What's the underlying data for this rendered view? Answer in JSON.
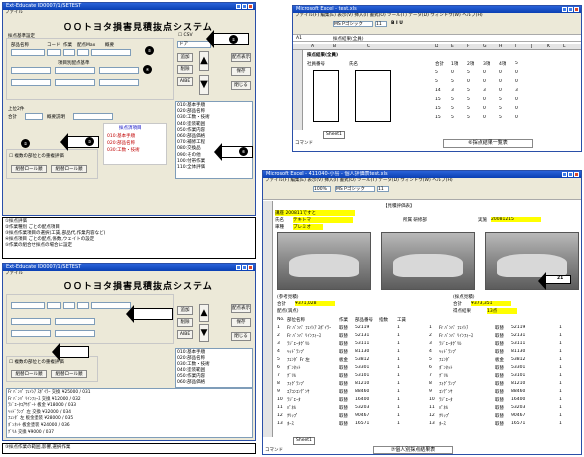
{
  "win1": {
    "title": "Ext-Educate ID0007/1/SETEST",
    "app_title": "ＯＯトヨタ損害見積抜点システム",
    "menu": "ファイル",
    "labels": [
      "採点基準設定",
      "部品名称",
      "コード",
      "作業",
      "配点Max",
      "概要",
      "配点合計",
      "項目別配点基準",
      "上位2件",
      "合計",
      "概要説明",
      "部分点(%)"
    ],
    "checkboxes": [
      "CSV",
      "複数の部位との重複評価",
      "削除ガイド",
      "設定評価"
    ],
    "buttons": [
      "追加",
      "削除",
      "保存",
      "閉じる",
      "配点表示",
      "AIBE",
      "組替ロール順",
      "組替ロール順"
    ],
    "combo": "ドア",
    "panel_title": "採点済項目",
    "list_items": [
      "010:基本手順",
      "020:部品名称",
      "030:工数・技術",
      "040:塗装範囲",
      "050:作業内容",
      "060:部品価格",
      "070:補修工程",
      "080:交換品",
      "090:その他",
      "100:付帯作業",
      "110:全体評価"
    ],
    "markers": [
      "①",
      "②",
      "③",
      "④",
      "⑤",
      "⑥"
    ]
  },
  "notes1": [
    "①採点評価",
    "②作業種別 ごとの配点項目",
    "③採点作業項目の選択(工賃,部品代,作業内容など)",
    "④採点項目 ごとの配点,係数,ウェイトの設定",
    "⑤作業の組合せ採点の場合に設定"
  ],
  "win2": {
    "title": "Ext-Educate ID0007/1/SETEST",
    "app_title": "ＯＯトヨタ損害見積抜点システム",
    "buttons": [
      "追加",
      "削除",
      "保存",
      "閉じる",
      "配点表示",
      "AIBE"
    ],
    "list_items": [
      "010:基本手順",
      "020:部品名称",
      "030:工数・技術",
      "040:塗装範囲",
      "050:作業内容",
      "060:部品価格"
    ],
    "log_lines": [
      "Fr ﾊﾞﾝﾊﾟ ﾌｪｲｼｱ ｽﾎﾟｲﾗｰ 交換 ¥25000 / 031",
      "Fr ﾊﾞﾝﾊﾟ ﾘｲﾝﾌｫｰｽ 交換 ¥12000 / 032",
      "ﾗｼﾞｴｰﾀｺｱｻﾎﾟｰﾄ 板金 ¥18000 / 033",
      "ﾍｯﾄﾞﾗﾝﾌﾟ 左 交換 ¥32000 / 034",
      "ﾌｪﾝﾀﾞ 左 板金塗装 ¥28000 / 035",
      "ﾎﾞﾝﾈｯﾄ 板金塗装 ¥24000 / 036",
      "ｸﾞﾘﾙ 交換 ¥9000 / 037"
    ]
  },
  "notes2": [
    "③採点作業の範囲,影響,選択作業"
  ],
  "excel1": {
    "title": "Microsoft Excel - test.xls",
    "menu": [
      "ファイル(F)",
      "編集(E)",
      "表示(V)",
      "挿入(I)",
      "書式(O)",
      "ツール(T)",
      "データ(D)",
      "ウィンドウ(W)",
      "ヘルプ(H)"
    ],
    "font": "MS Pゴシック",
    "size": "11",
    "cell_ref": "A1",
    "formula": "採点結果(全員)",
    "columns": [
      "A",
      "B",
      "C",
      "D",
      "E",
      "F",
      "G",
      "H",
      "I",
      "J",
      "K",
      "L"
    ],
    "heading": "採点結果(全員)",
    "headers": [
      "社員番号",
      "氏名",
      "合計",
      "1項",
      "2項",
      "3項",
      "4項",
      "5"
    ],
    "rows": [
      [
        "5",
        "0",
        "5",
        "0",
        "0",
        "0"
      ],
      [
        "5",
        "5",
        "0",
        "0",
        "0",
        "0"
      ],
      [
        "14",
        "3",
        "5",
        "3",
        "0",
        "3"
      ],
      [
        "15",
        "5",
        "5",
        "0",
        "5",
        "0"
      ],
      [
        "15",
        "5",
        "5",
        "0",
        "5",
        "0"
      ],
      [
        "15",
        "5",
        "5",
        "0",
        "5",
        "0"
      ]
    ],
    "sheet": "Sheet1",
    "status": "コマンド",
    "caption": "⑥採点結果一覧表"
  },
  "excel2": {
    "title": "Microsoft Excel - 411040-小島 - 個人評価表test.xls",
    "menu": [
      "ファイル(F)",
      "編集(E)",
      "表示(V)",
      "挿入(I)",
      "書式(O)",
      "ツール(T)",
      "データ(D)",
      "ウィンドウ(W)",
      "ヘルプ(H)"
    ],
    "zoom": "100%",
    "font": "MS Pゴシック",
    "size": "11",
    "sheet_title": "【見積評価表】",
    "fields": {
      "course": "講座",
      "course_val": "200811ですと",
      "name": "氏名",
      "name_val": "テキトマ",
      "shop": "所属",
      "shop_val": "所属 研修部",
      "date": "実施",
      "date_val": "20081215",
      "car": "車種",
      "car_val": "プレミオ"
    },
    "photo_label": "21",
    "mid": {
      "ref": "(参考見積)",
      "ref_total": "合計",
      "ref_amount": "¥371,028",
      "ref_pts": "配点(満点)",
      "score": "(採点見積)",
      "score_total": "合計",
      "score_amount": "¥373,351",
      "pts": "得点結果",
      "pts_val": "13点"
    },
    "table_headers": [
      "No.",
      "部位名称",
      "作業",
      "部品番号",
      "指数",
      "工賃"
    ],
    "table_rows": [
      [
        "1",
        "Fr ﾊﾞﾝﾊﾟ ﾌｪｲｼｱ ｽﾎﾟｲﾗｰ",
        "取替",
        "52119",
        "",
        "1"
      ],
      [
        "2",
        "Fr ﾊﾞﾝﾊﾟ ﾘｲﾝﾌｫｰｽ",
        "取替",
        "52131",
        "",
        "1"
      ],
      [
        "3",
        "ﾗｼﾞｴｰﾀｸﾞﾘﾙ",
        "取替",
        "53111",
        "",
        "1"
      ],
      [
        "4",
        "ﾍｯﾄﾞﾗﾝﾌﾟ",
        "取替",
        "81130",
        "",
        "1"
      ],
      [
        "5",
        "ﾌｪﾝﾀﾞ Fr 左",
        "板金",
        "53812",
        "",
        "1"
      ],
      [
        "6",
        "ﾎﾞﾝﾈｯﾄ",
        "取替",
        "53301",
        "",
        "1"
      ],
      [
        "7",
        "ｸﾞﾘﾙ",
        "取替",
        "53101",
        "",
        "1"
      ],
      [
        "8",
        "ﾌｫｸﾞﾗﾝﾌﾟ",
        "取替",
        "81210",
        "",
        "1"
      ],
      [
        "9",
        "ｴｱｺﾝｺﾝﾃﾞﾝｻ",
        "取替",
        "88460",
        "",
        "1"
      ],
      [
        "10",
        "ﾗｼﾞｴｰﾀ",
        "取替",
        "16400",
        "",
        "1"
      ],
      [
        "11",
        "ﾊﾟﾈﾙ",
        "取替",
        "53203",
        "",
        "1"
      ],
      [
        "12",
        "ｸﾘｯﾌﾟ",
        "取替",
        "90467",
        "",
        "1"
      ],
      [
        "13",
        "ﾎｰｽ",
        "取替",
        "16571",
        "",
        "1"
      ]
    ],
    "right_rows": [
      [
        "1",
        "Fr ﾊﾞﾝﾊﾟ ﾌｪｲｼｱ",
        "取替",
        "52119",
        "1"
      ],
      [
        "2",
        "Fr ﾊﾞﾝﾊﾟ ﾘｲﾝﾌｫｰｽ",
        "取替",
        "52131",
        "1"
      ],
      [
        "3",
        "ﾗｼﾞｴｰﾀｸﾞﾘﾙ",
        "取替",
        "53111",
        "1"
      ],
      [
        "4",
        "ﾍｯﾄﾞﾗﾝﾌﾟ",
        "取替",
        "81130",
        "1"
      ],
      [
        "5",
        "ﾌｪﾝﾀﾞ",
        "板金",
        "53812",
        "1"
      ],
      [
        "6",
        "ﾎﾞﾝﾈｯﾄ",
        "取替",
        "53301",
        "1"
      ],
      [
        "7",
        "ｸﾞﾘﾙ",
        "取替",
        "53101",
        "1"
      ],
      [
        "8",
        "ﾌｫｸﾞﾗﾝﾌﾟ",
        "取替",
        "81210",
        "1"
      ],
      [
        "9",
        "ｺﾝﾃﾞﾝｻ",
        "取替",
        "88460",
        "1"
      ],
      [
        "10",
        "ﾗｼﾞｴｰﾀ",
        "取替",
        "16400",
        "1"
      ],
      [
        "11",
        "ﾊﾟﾈﾙ",
        "取替",
        "53203",
        "1"
      ],
      [
        "12",
        "ｸﾘｯﾌﾟ",
        "取替",
        "90467",
        "1"
      ],
      [
        "13",
        "ﾎｰｽ",
        "取替",
        "16571",
        "1"
      ]
    ],
    "sheet": "Sheet1",
    "status": "コマンド",
    "caption": "⑦個人別採点結果表"
  }
}
